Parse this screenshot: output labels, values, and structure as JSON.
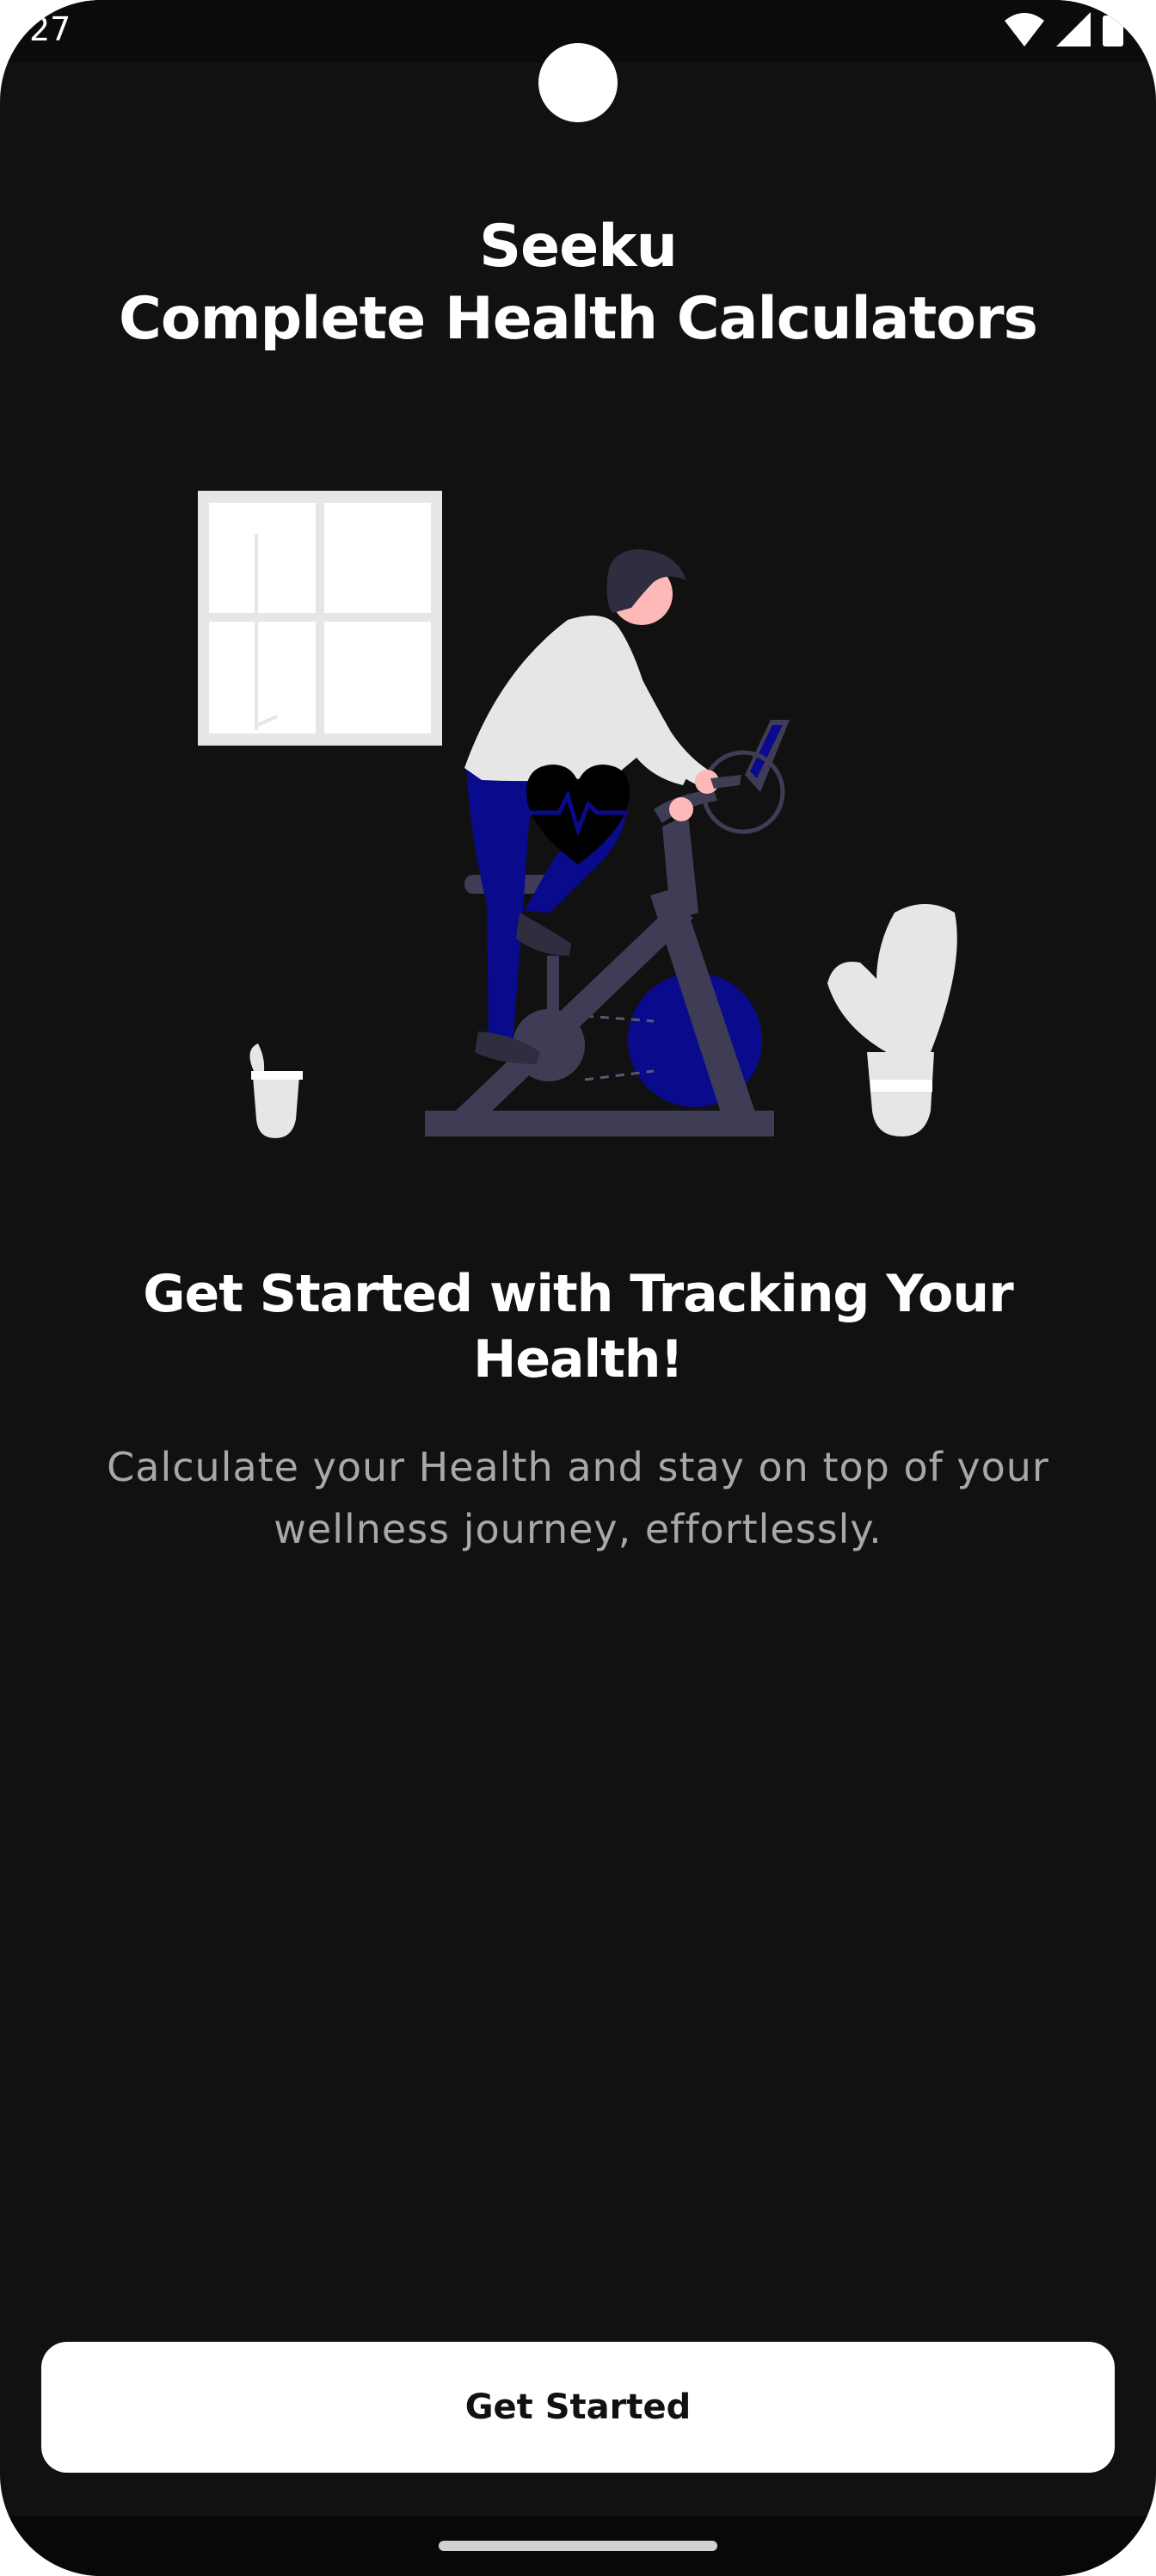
{
  "status_bar": {
    "time": "27",
    "icons": [
      "wifi-icon",
      "cellular-signal-icon",
      "battery-icon"
    ]
  },
  "app": {
    "title_line1": "Seeku",
    "title_line2": "Complete Health Calculators"
  },
  "hero": {
    "illustration": "person-on-exercise-bike-with-heart-rate-icon"
  },
  "content": {
    "headline": "Get Started with Tracking Your Health!",
    "subtitle": "Calculate your Health and stay on top of your wellness journey, effortlessly."
  },
  "cta": {
    "label": "Get Started"
  },
  "colors": {
    "background": "#111111",
    "text_primary": "#ffffff",
    "text_secondary": "#a8a8a8",
    "button_bg": "#ffffff",
    "button_text": "#111111",
    "accent_navy": "#0a0a8c",
    "bike_gray": "#3f3d56"
  }
}
